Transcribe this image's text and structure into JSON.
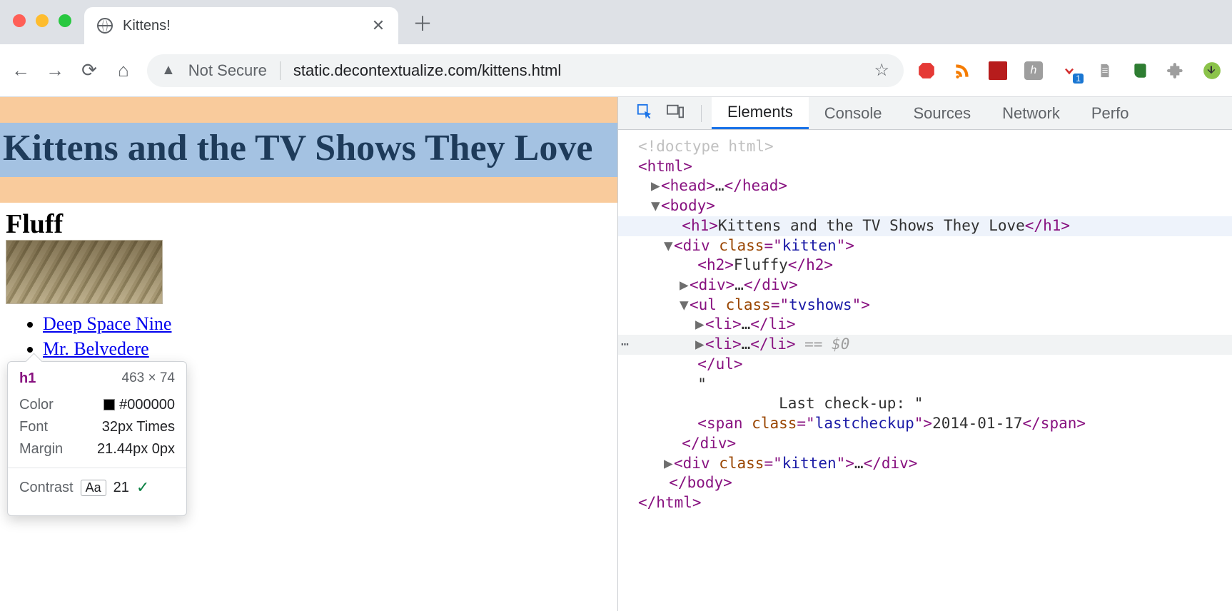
{
  "browser": {
    "tab_title": "Kittens!",
    "not_secure_label": "Not Secure",
    "url": "static.decontextualize.com/kittens.html",
    "download_badge": "1"
  },
  "page": {
    "h1": "Kittens and the TV Shows They Love",
    "h2_peek": "Fluff",
    "tvshows": [
      "Deep Space Nine",
      "Mr. Belvedere"
    ]
  },
  "tooltip": {
    "tag": "h1",
    "dimensions": "463 × 74",
    "rows": {
      "color_label": "Color",
      "color_value": "#000000",
      "font_label": "Font",
      "font_value": "32px Times",
      "margin_label": "Margin",
      "margin_value": "21.44px 0px"
    },
    "contrast_label": "Contrast",
    "contrast_aa": "Aa",
    "contrast_value": "21"
  },
  "devtools": {
    "tabs": {
      "elements": "Elements",
      "console": "Console",
      "sources": "Sources",
      "network": "Network",
      "perf": "Perfo"
    },
    "dom": {
      "doctype": "<!doctype html>",
      "html_open": "html",
      "head": "head",
      "body": "body",
      "h1_text": "Kittens and the TV Shows They Love",
      "kitten_class": "kitten",
      "h2_text": "Fluffy",
      "tvshows_class": "tvshows",
      "li_ellipsis": "…",
      "eq0": " == $0",
      "text_lastcheckup": "Last check-up: \"",
      "quote": "\"",
      "lastcheckup_class": "lastcheckup",
      "lastcheckup_text": "2014-01-17"
    }
  }
}
